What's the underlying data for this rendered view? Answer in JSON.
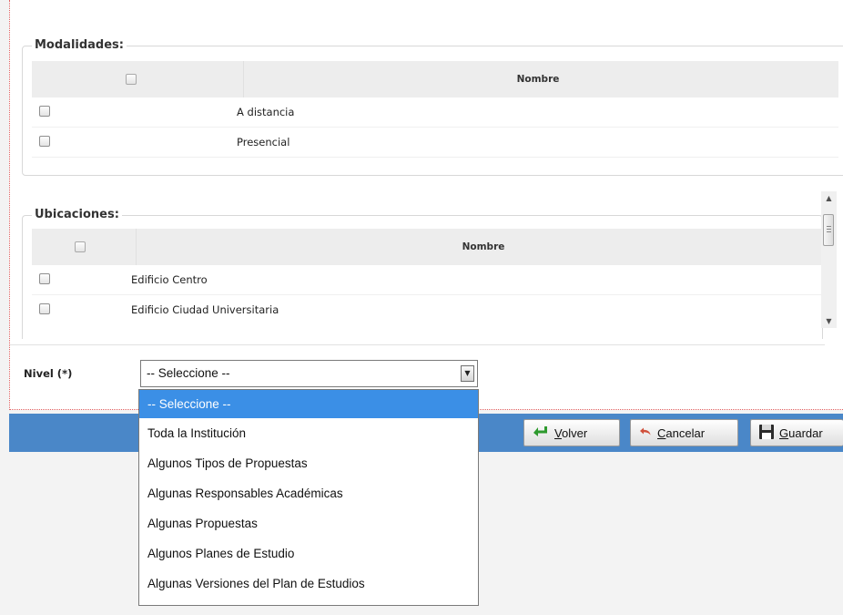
{
  "modalidades": {
    "legend": "Modalidades:",
    "header": "Nombre",
    "items": [
      "A distancia",
      "Presencial"
    ]
  },
  "ubicaciones": {
    "legend": "Ubicaciones:",
    "header": "Nombre",
    "items": [
      "Edificio Centro",
      "Edificio Ciudad Universitaria"
    ]
  },
  "nivel": {
    "label": "Nivel (*)",
    "selected": "-- Seleccione --",
    "options": [
      "-- Seleccione --",
      "Toda la Institución",
      "Algunos Tipos de Propuestas",
      "Algunas Responsables Académicas",
      "Algunas Propuestas",
      "Algunos Planes de Estudio",
      "Algunas Versiones del Plan de Estudios"
    ]
  },
  "toolbar": {
    "volver": "Volver",
    "cancelar": "Cancelar",
    "guardar": "Guardar"
  },
  "colors": {
    "toolbar_bg": "#4a87c8",
    "selected_option": "#3b8fe6",
    "volver_icon": "#2e9a2e",
    "cancelar_icon": "#d0503b"
  },
  "icons": {
    "volver": "back-arrow-icon",
    "cancelar": "undo-arrow-icon",
    "guardar": "save-icon"
  }
}
